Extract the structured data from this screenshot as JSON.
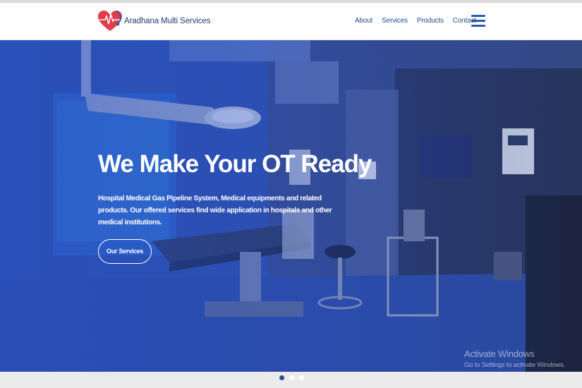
{
  "brand": {
    "name": "Aradhana Multi Services",
    "accent": "#e23b4a",
    "nav_color": "#234f8f"
  },
  "nav": {
    "items": [
      "About",
      "Services",
      "Products",
      "Contact"
    ],
    "menu_icon": "hamburger-menu-icon"
  },
  "hero": {
    "title": "We Make Your OT Ready",
    "description": "Hospital Medical Gas Pipeline System, Medical equipments and related products. Our offered services find wide application in hospitals and other medical institutions.",
    "button_label": "Our Services"
  },
  "watermark": {
    "line1": "Activate Windows",
    "line2": "Go to Settings to activate Windows."
  },
  "carousel": {
    "slides": 3,
    "active": 1
  }
}
